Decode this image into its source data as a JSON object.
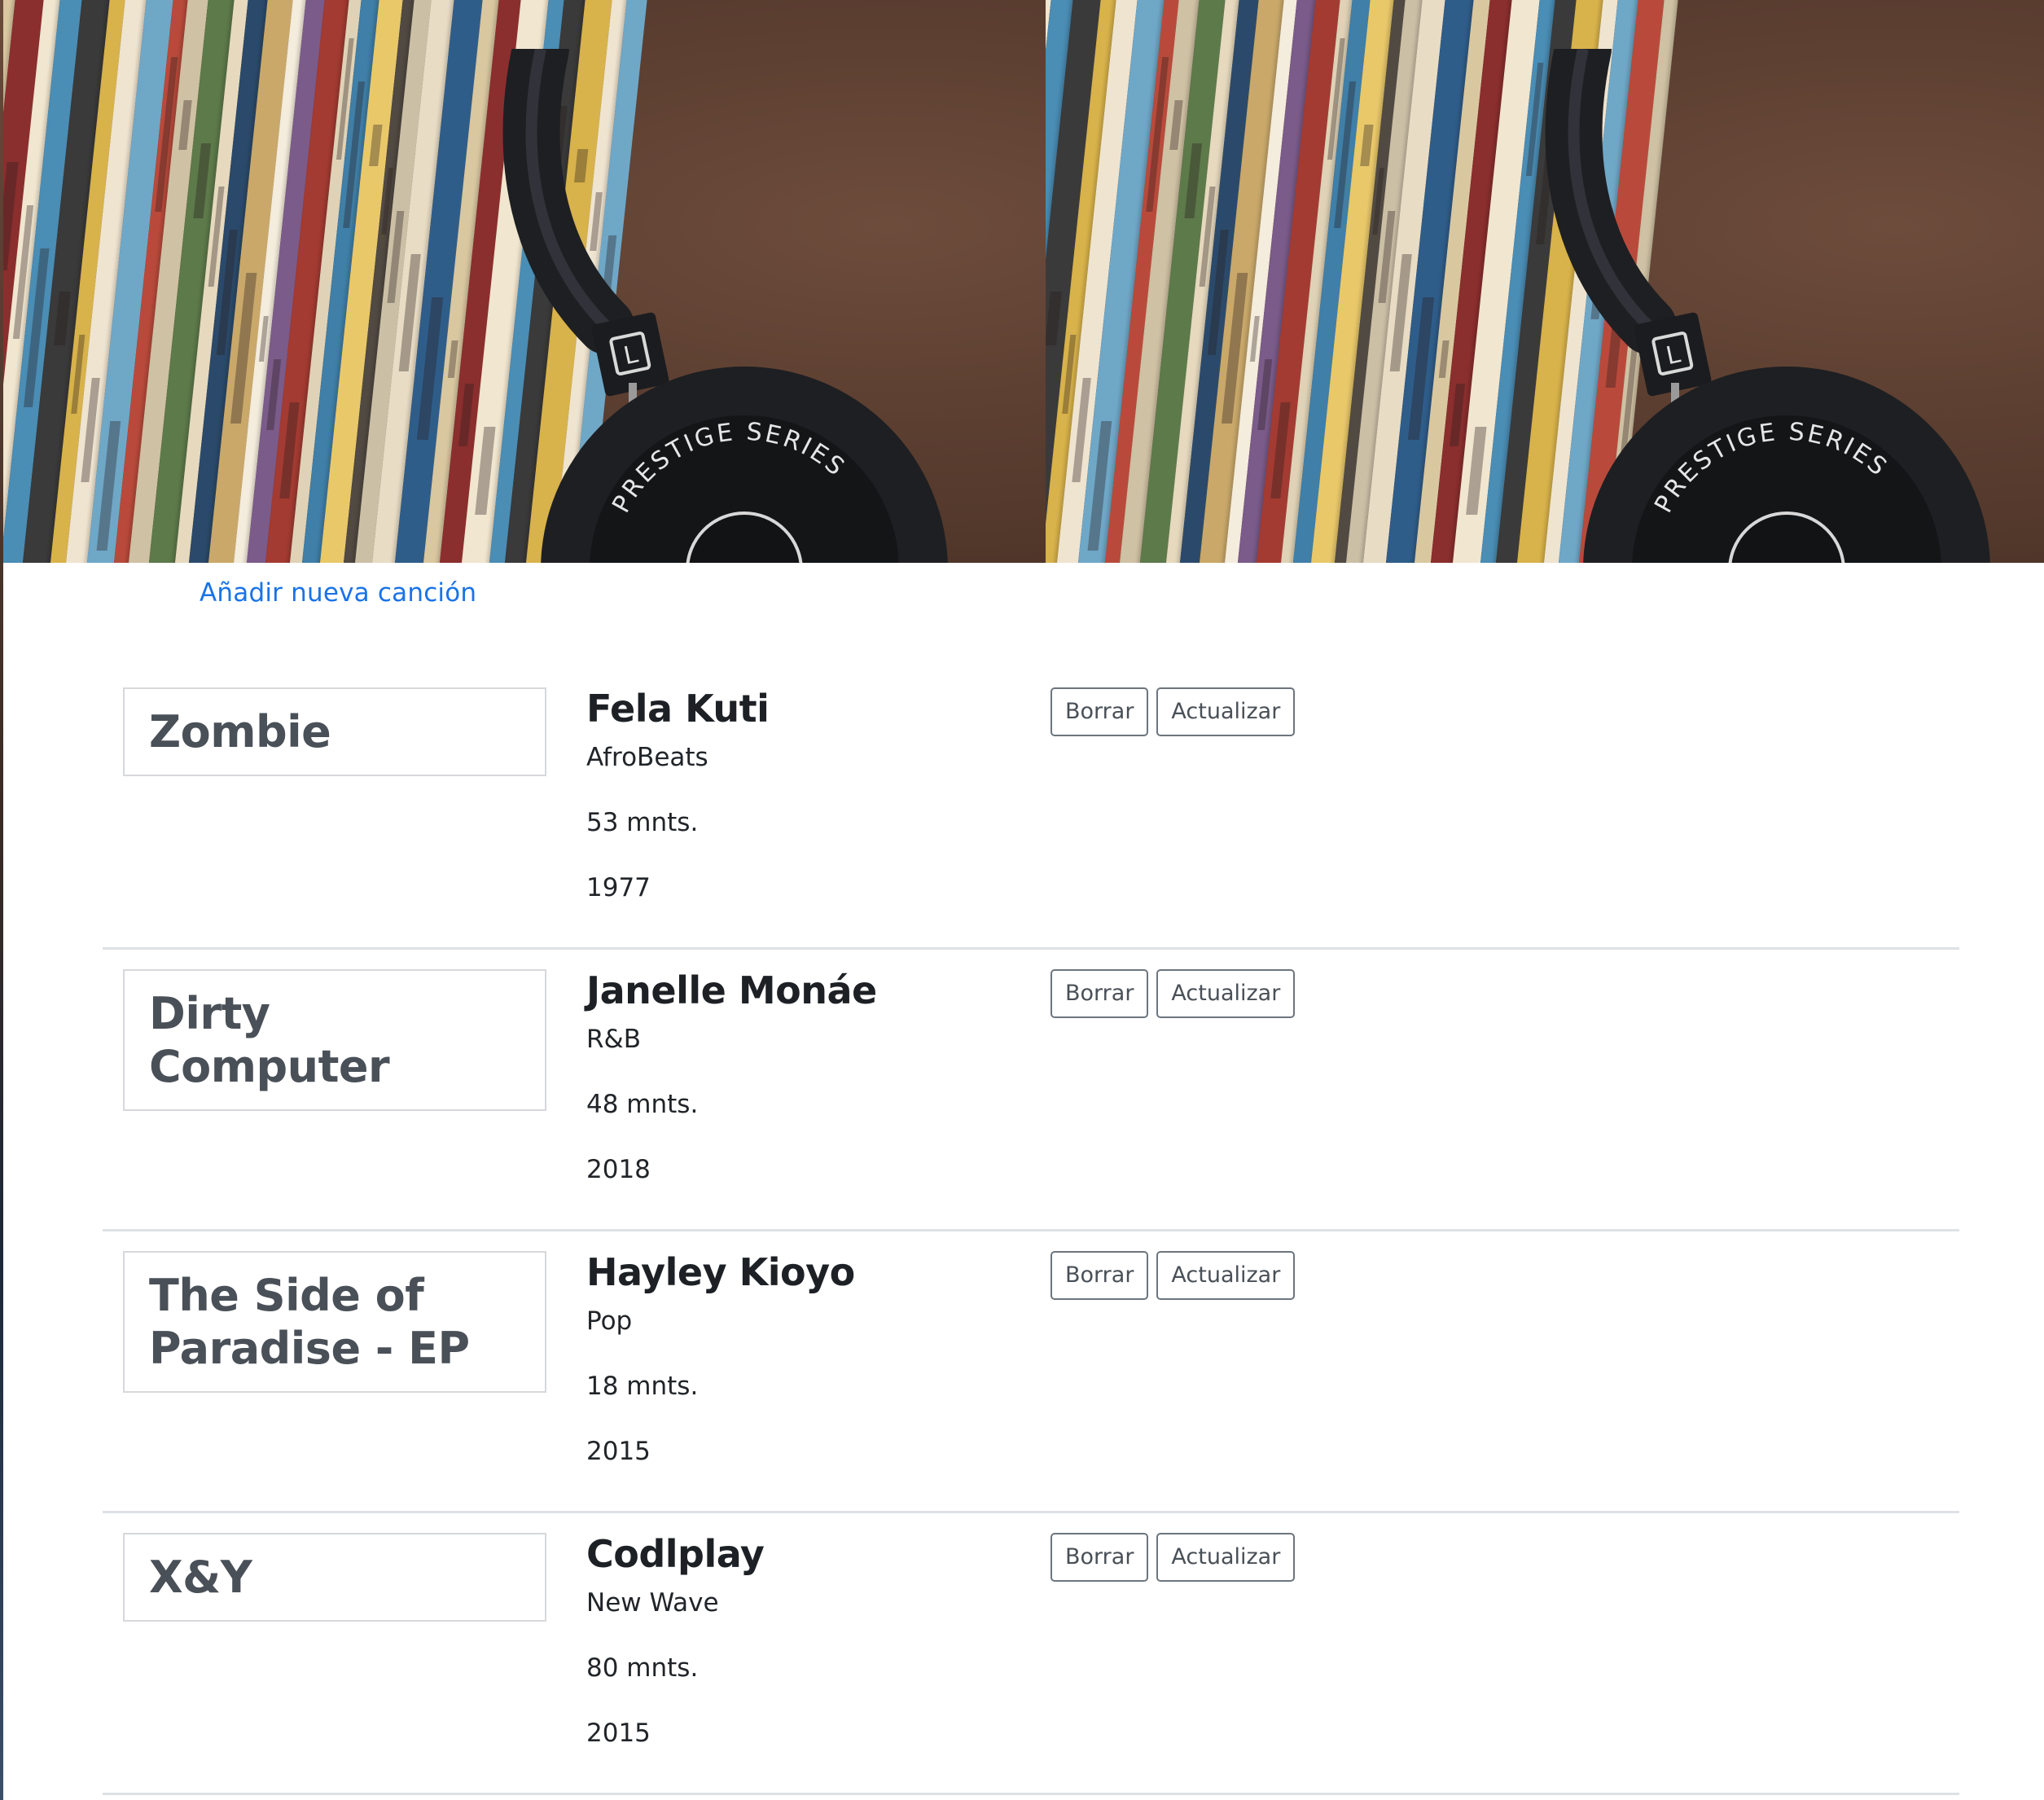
{
  "hero": {
    "image_alt": "vinyl-records-and-headphones",
    "colors": {
      "wall": "#5c3f31",
      "headphones": "#1e1f22"
    },
    "headphone_print": "PRESTIGE SERIES"
  },
  "add_song_link": "Añadir nueva canción",
  "songs": [
    {
      "title": "Zombie",
      "artist": "Fela Kuti",
      "genre": "AfroBeats",
      "duration": "53 mnts.",
      "year": "1977",
      "delete_label": "Borrar",
      "update_label": "Actualizar"
    },
    {
      "title": "Dirty Computer",
      "artist": "Janelle Monáe",
      "genre": "R&B",
      "duration": "48 mnts.",
      "year": "2018",
      "delete_label": "Borrar",
      "update_label": "Actualizar"
    },
    {
      "title": "The Side of Paradise - EP",
      "artist": "Hayley Kioyo",
      "genre": "Pop",
      "duration": "18 mnts.",
      "year": "2015",
      "delete_label": "Borrar",
      "update_label": "Actualizar"
    },
    {
      "title": "X&Y",
      "artist": "Codlplay",
      "genre": "New Wave",
      "duration": "80 mnts.",
      "year": "2015",
      "delete_label": "Borrar",
      "update_label": "Actualizar"
    }
  ],
  "colors": {
    "link": "#1a73e8",
    "border": "#dee2e6",
    "button_border": "#6c757d"
  }
}
